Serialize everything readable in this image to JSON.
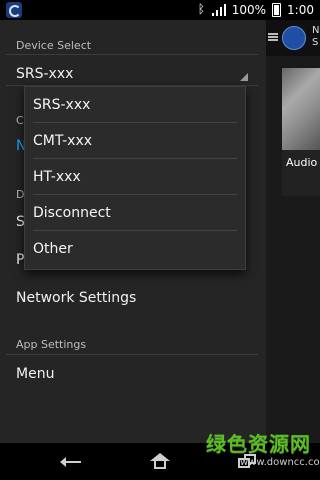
{
  "status_bar": {
    "battery": "100%",
    "time": "1:00"
  },
  "drawer": {
    "device_select_header": "Device Select",
    "device_select_value": "SRS-xxx",
    "hidden_initial_1": "C",
    "hidden_initial_2": "N",
    "hidden_initial_3": "D",
    "hidden_initial_4": "S",
    "hidden_initial_5": "P",
    "network_settings": "Network Settings",
    "app_settings_header": "App Settings",
    "menu": "Menu"
  },
  "dropdown": {
    "items": [
      "SRS-xxx",
      "CMT-xxx",
      "HT-xxx",
      "Disconnect",
      "Other"
    ]
  },
  "right_panel": {
    "title_line1": "N",
    "title_line2": "S",
    "audio_label": "Audio"
  },
  "watermark": {
    "text": "绿色资源网",
    "url": "www.downcc.com"
  },
  "colors": {
    "background": "#252525",
    "accent": "#1ea7ff",
    "watermark_green": "#59c11f"
  }
}
